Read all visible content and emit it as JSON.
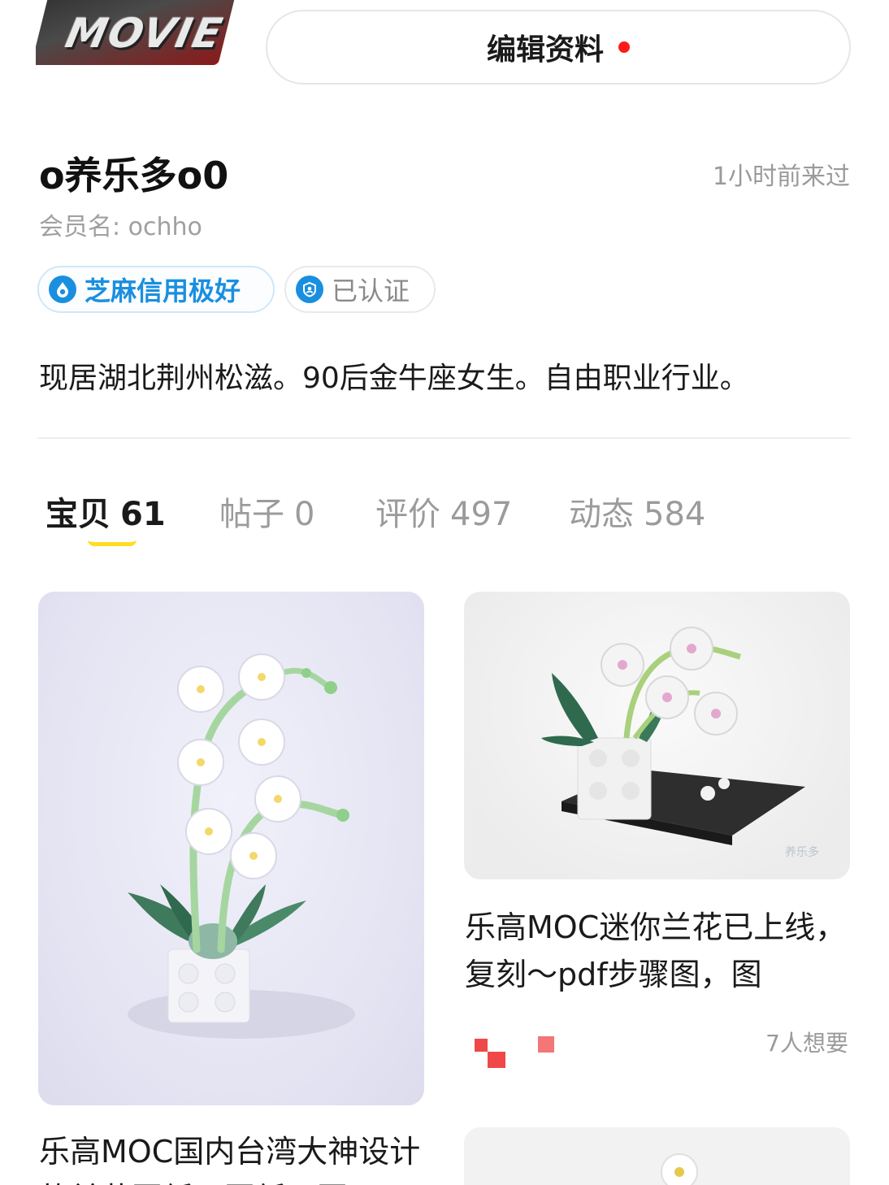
{
  "header": {
    "avatar_text": "MOVIE",
    "edit_button_label": "编辑资料"
  },
  "profile": {
    "nickname": "o养乐多o0",
    "last_visit": "1小时前来过",
    "member_name": "会员名: ochho",
    "badges": {
      "credit": "芝麻信用极好",
      "verified": "已认证"
    },
    "bio": "现居湖北荆州松滋。90后金牛座女生。自由职业行业。"
  },
  "tabs": [
    {
      "label": "宝贝",
      "count": "61",
      "active": true
    },
    {
      "label": "帖子",
      "count": "0",
      "active": false
    },
    {
      "label": "评价",
      "count": "497",
      "active": false
    },
    {
      "label": "动态",
      "count": "584",
      "active": false
    }
  ],
  "items": [
    {
      "title": "乐高MOC国内台湾大神设计的兰花图纸！图纸！图",
      "image": "white orchid lego moc"
    },
    {
      "title": "乐高MOC迷你兰花已上线，复刻～pdf步骤图，图",
      "image": "mini orchid lego moc",
      "watermark": "养乐多",
      "wants": "7人想要"
    },
    {
      "title": "",
      "image": "flower lego moc"
    }
  ],
  "colors": {
    "accent_yellow": "#ffdd22",
    "credit_blue": "#1a8fe0",
    "notification_red": "#ff1a1a"
  }
}
